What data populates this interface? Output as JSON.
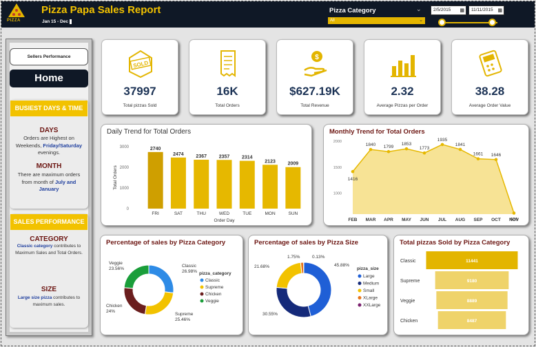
{
  "header": {
    "title": "Pizza Papa Sales Report",
    "logo_text": "PIZZA",
    "date_range": "Jan 15 - Dec",
    "category_label": "Pizza Category",
    "category_value": "All",
    "date_start": "2/5/2015",
    "date_end": "11/11/2015",
    "date_slider": [
      0.03,
      0.9
    ]
  },
  "sidebar": {
    "sellers_button": "Sellers Performance",
    "home_button": "Home",
    "busiest_heading": "BUSIEST  DAYS & TIME",
    "days_title": "DAYS",
    "days_text_1": "Orders are Highest on Weekends,",
    "days_text_2": "Friday/Saturday",
    "days_text_3": "evenings.",
    "month_title": "MONTH",
    "month_text_1": "There are maximum orders from month of",
    "month_text_2": "July and January",
    "sales_heading": "SALES PERFORMANCE",
    "category_title": "CATEGORY",
    "category_text_1": "Classic category",
    "category_text_2": "contributes to Maximum Sales and Total Orders.",
    "size_title": "SIZE",
    "size_text_1": "Large size pizza",
    "size_text_2": "contributes to maximum sales."
  },
  "kpis": [
    {
      "value": "37997",
      "label": "Total pizzas Sold",
      "icon": "sold-box-icon"
    },
    {
      "value": "16K",
      "label": "Total Orders",
      "icon": "receipt-icon"
    },
    {
      "value": "$627.19K",
      "label": "Total Revenue",
      "icon": "money-hand-icon"
    },
    {
      "value": "2.32",
      "label": "Average Pizzas per Order",
      "icon": "bar-chart-icon"
    },
    {
      "value": "38.28",
      "label": "Average Order Value",
      "icon": "calculator-icon"
    }
  ],
  "colors": {
    "gold": "#e3b500",
    "navy": "#0f1826",
    "classic": "#2e8be6",
    "supreme": "#f2c200",
    "chicken": "#6b1e1e",
    "veggie": "#1a9e3a",
    "large": "#1f5fd6",
    "medium": "#152a7a",
    "small": "#f2c200",
    "xlarge": "#e8741a",
    "xxlarge": "#7a1f6e"
  },
  "chart_data": [
    {
      "type": "bar",
      "title": "Daily Trend for Total Orders",
      "xlabel": "Order Day",
      "ylabel": "Total Orders",
      "categories": [
        "FRI",
        "SAT",
        "THU",
        "WED",
        "TUE",
        "MON",
        "SUN"
      ],
      "values": [
        2740,
        2474,
        2367,
        2357,
        2314,
        2123,
        2009
      ],
      "yticks": [
        0,
        1000,
        2000,
        3000
      ],
      "ylim": [
        0,
        3000
      ]
    },
    {
      "type": "area",
      "title": "Monthly Trend for Total Orders",
      "categories": [
        "FEB",
        "MAR",
        "APR",
        "MAY",
        "JUN",
        "JUL",
        "AUG",
        "SEP",
        "OCT",
        "NOV"
      ],
      "values": [
        1416,
        1840,
        1799,
        1853,
        1773,
        1935,
        1841,
        1661,
        1646,
        620
      ],
      "yticks": [
        1000,
        1500,
        2000
      ],
      "ylim": [
        600,
        2000
      ]
    },
    {
      "type": "pie",
      "title": "Percentage of sales by Pizza Category",
      "legend_title": "pizza_category",
      "slices": [
        {
          "name": "Classic",
          "value": 26.98,
          "label": "26.98%"
        },
        {
          "name": "Supreme",
          "value": 25.46,
          "label": "25.46%"
        },
        {
          "name": "Chicken",
          "value": 24.0,
          "label": "24%"
        },
        {
          "name": "Veggie",
          "value": 23.56,
          "label": "23.56%"
        }
      ]
    },
    {
      "type": "pie",
      "title": "Percentage of sales by Pizza Size",
      "legend_title": "pizza_size",
      "legend": [
        "Large",
        "Medium",
        "Small",
        "XLarge",
        "XXLarge"
      ],
      "slices": [
        {
          "name": "Large",
          "value": 45.88,
          "label": "45.88%"
        },
        {
          "name": "Medium",
          "value": 30.55,
          "label": "30.55%"
        },
        {
          "name": "Small",
          "value": 21.68,
          "label": "21.68%"
        },
        {
          "name": "XLarge",
          "value": 1.75,
          "label": "1.75%"
        },
        {
          "name": "XXLarge",
          "value": 0.13,
          "label": "0.13%"
        }
      ]
    },
    {
      "type": "bar",
      "title": "Total pizzas Sold by Pizza Category",
      "categories": [
        "Classic",
        "Supreme",
        "Veggie",
        "Chicken"
      ],
      "values": [
        11441,
        9180,
        8889,
        8487
      ]
    }
  ]
}
